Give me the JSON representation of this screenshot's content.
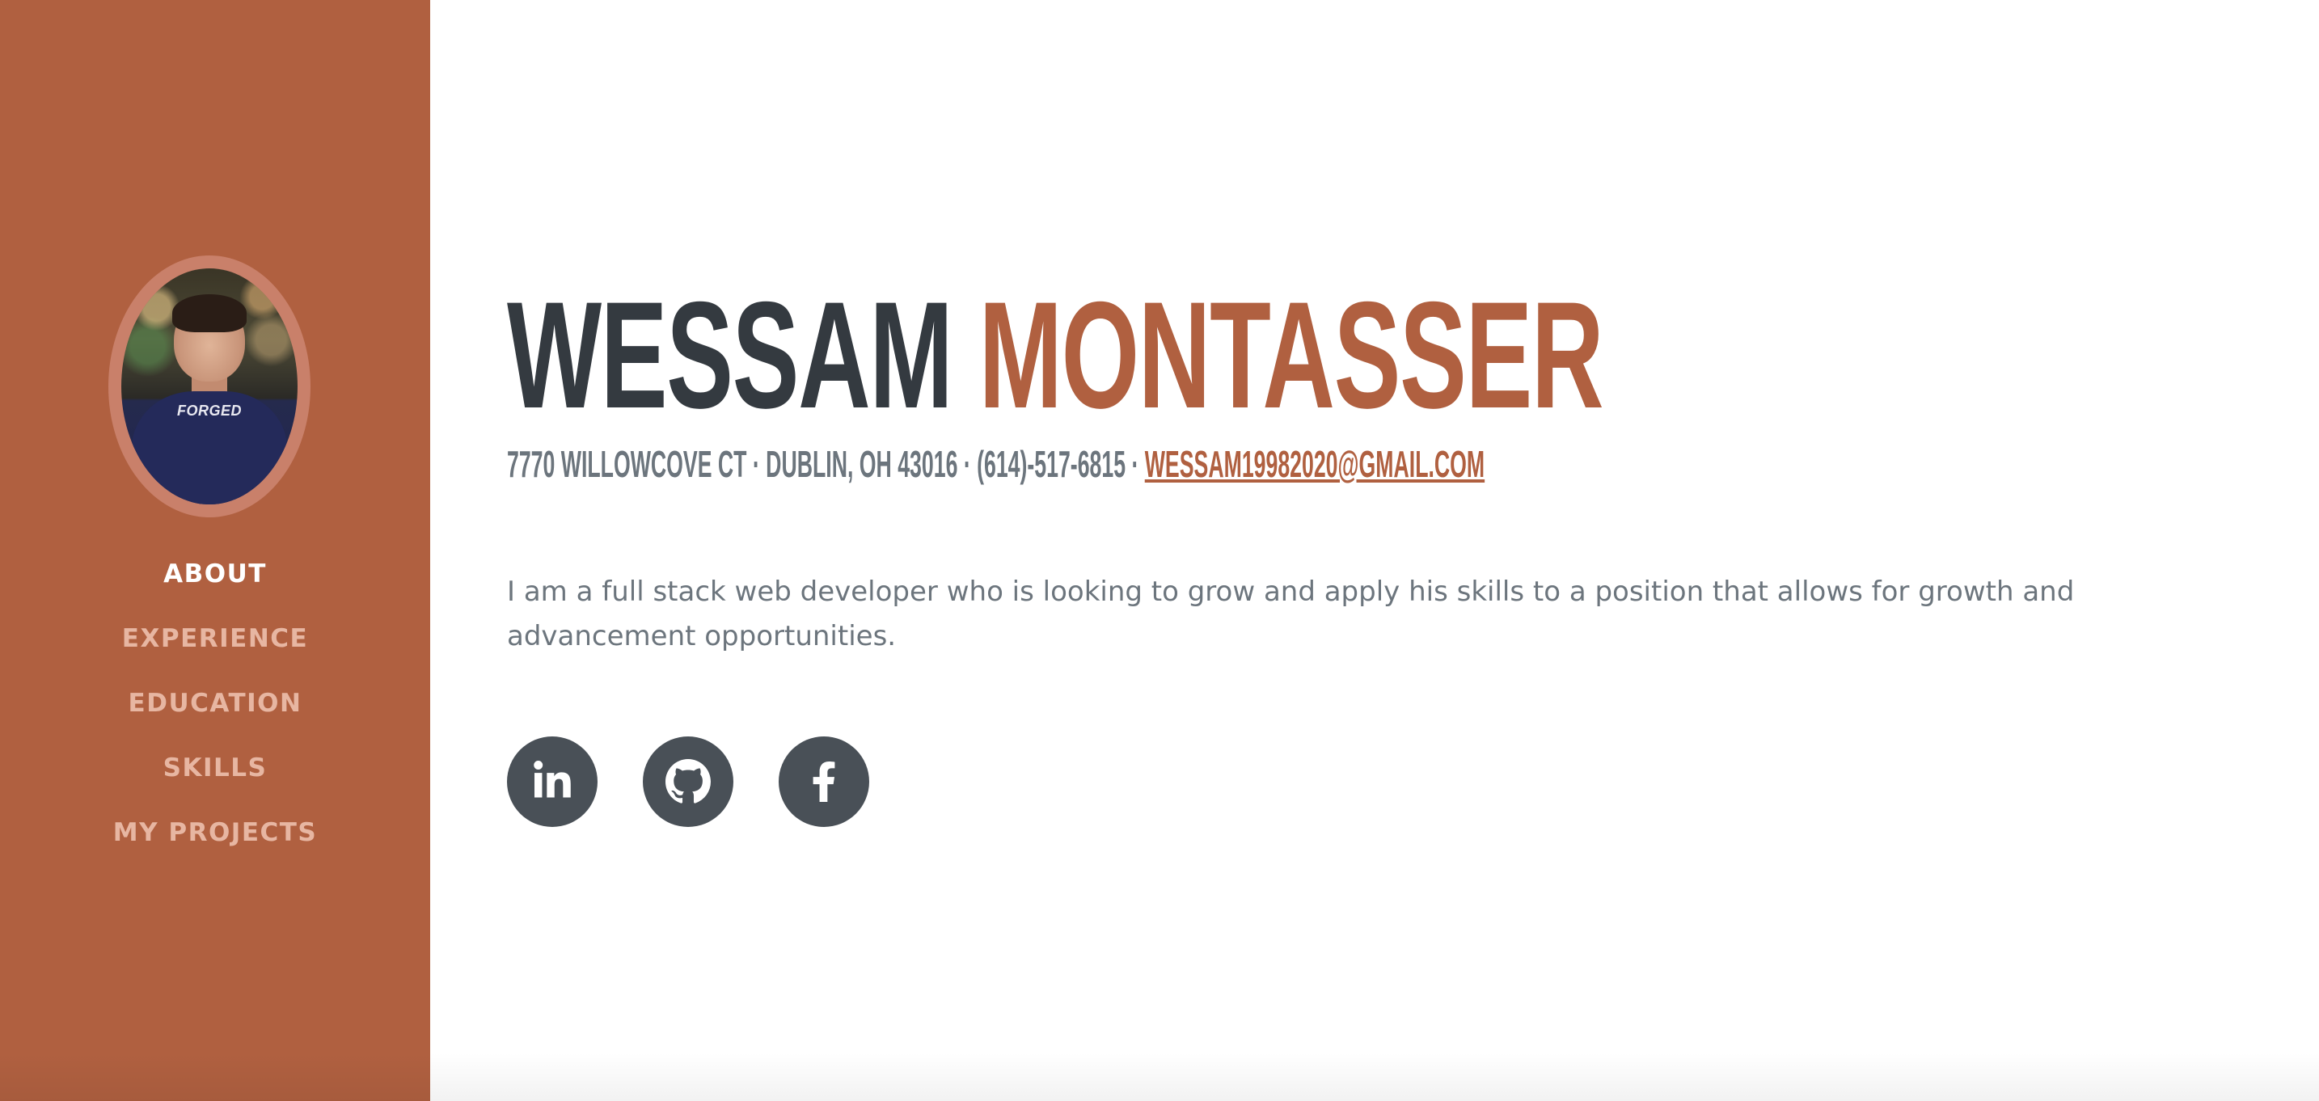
{
  "colors": {
    "primary": "#b06040",
    "sidebar_bg": "#b06040",
    "nav_active": "#ffffff",
    "nav_inactive": "#e7b6a2",
    "heading_dark": "#343a40",
    "text_muted": "#6c757d",
    "social_bg": "#495057"
  },
  "profile": {
    "shirt_text": "FORGED"
  },
  "nav": {
    "items": [
      {
        "label": "ABOUT",
        "active": true
      },
      {
        "label": "EXPERIENCE",
        "active": false
      },
      {
        "label": "EDUCATION",
        "active": false
      },
      {
        "label": "SKILLS",
        "active": false
      },
      {
        "label": "MY PROJECTS",
        "active": false
      }
    ]
  },
  "about": {
    "first_name": "WESSAM",
    "last_name": "MONTASSER",
    "address": "7770 WILLOWCOVE CT · DUBLIN, OH 43016 · (614)-517-6815 · ",
    "email": "WESSAM19982020@GMAIL.COM",
    "bio": "I am a full stack web developer who is looking to grow and apply his skills to a position that allows for growth and advancement opportunities."
  },
  "socials": [
    {
      "icon": "linkedin-icon"
    },
    {
      "icon": "github-icon"
    },
    {
      "icon": "facebook-icon"
    }
  ]
}
